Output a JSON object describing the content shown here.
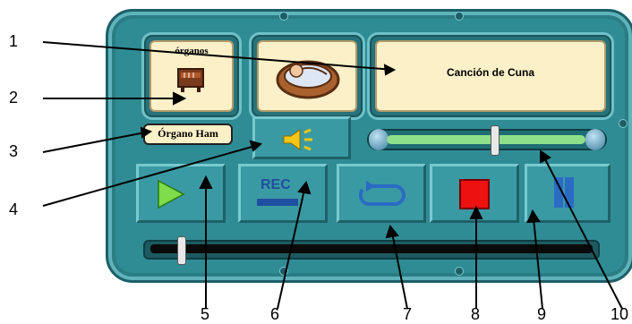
{
  "player": {
    "instrument_caption": "órganos",
    "instrument_label": "Órgano Ham",
    "song_title": "Canción de Cuna"
  },
  "buttons": {
    "rec_label": "REC"
  },
  "slider": {
    "volume_level": 0.25
  },
  "progress": {
    "position": 0.03
  },
  "callouts": [
    "1",
    "2",
    "3",
    "4",
    "5",
    "6",
    "7",
    "8",
    "9",
    "10"
  ]
}
